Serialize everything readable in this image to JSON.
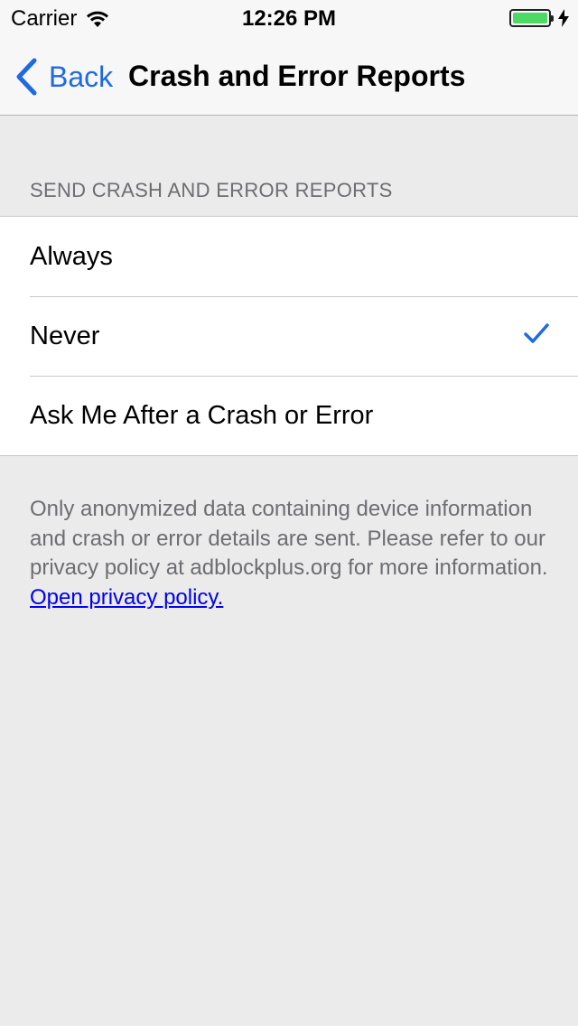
{
  "status_bar": {
    "carrier": "Carrier",
    "wifi_icon": "wifi-icon",
    "time": "12:26 PM",
    "battery_icon": "battery-charging-icon",
    "battery_color": "#4cd964"
  },
  "nav": {
    "back_label": "Back",
    "back_icon": "chevron-left-icon",
    "title": "Crash and Error Reports",
    "accent_color": "#1e6ae0"
  },
  "section": {
    "header": "SEND CRASH AND ERROR REPORTS",
    "options": [
      {
        "label": "Always",
        "selected": false
      },
      {
        "label": "Never",
        "selected": true
      },
      {
        "label": "Ask Me After a Crash or Error",
        "selected": false
      }
    ],
    "check_icon": "checkmark-icon"
  },
  "footer": {
    "text": "Only anonymized data containing device information and crash or error details are sent. Please refer to our privacy policy at adblockplus.org for more information.",
    "link_label": "Open privacy policy."
  }
}
